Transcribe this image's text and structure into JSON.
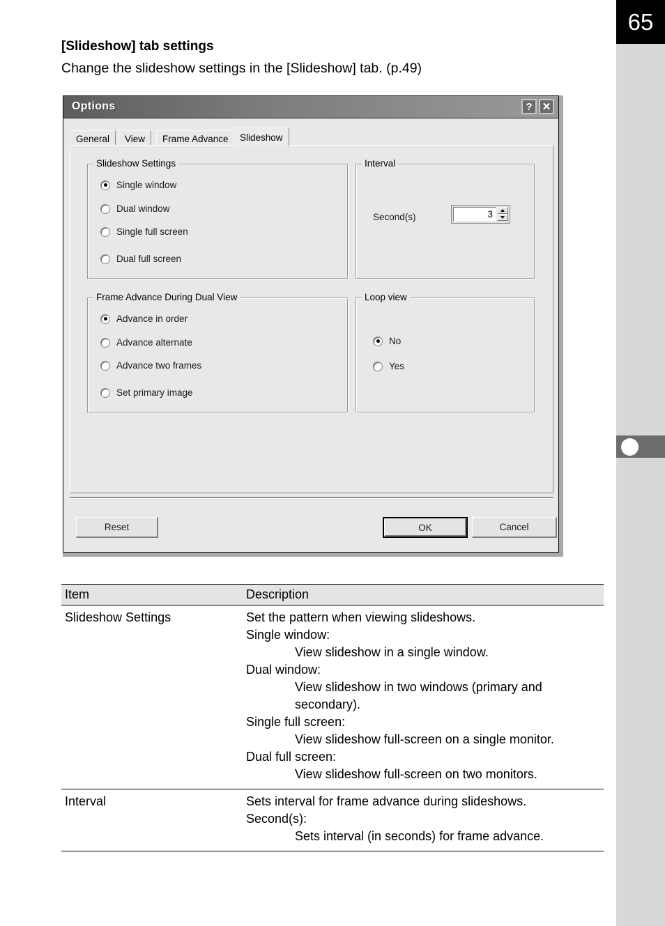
{
  "page": {
    "number": "65"
  },
  "heading": {
    "title": "[Slideshow] tab settings",
    "subtitle": "Change the slideshow settings in the [Slideshow] tab. (p.49)"
  },
  "dialog": {
    "title": "Options",
    "help_button": "?",
    "close_button": "✕",
    "tabs": [
      {
        "label": "General",
        "active": false
      },
      {
        "label": "View",
        "active": false
      },
      {
        "label": "Frame Advance",
        "active": false
      },
      {
        "label": "Slideshow",
        "active": true
      }
    ],
    "groups": {
      "slideshow_settings": {
        "title": "Slideshow Settings",
        "options": [
          {
            "label": "Single window",
            "checked": true
          },
          {
            "label": "Dual window",
            "checked": false
          },
          {
            "label": "Single full screen",
            "checked": false
          },
          {
            "label": "Dual full screen",
            "checked": false
          }
        ]
      },
      "interval": {
        "title": "Interval",
        "field_label": "Second(s)",
        "value": "3"
      },
      "frame_advance": {
        "title": "Frame Advance During Dual View",
        "options": [
          {
            "label": "Advance in order",
            "checked": true
          },
          {
            "label": "Advance alternate",
            "checked": false
          },
          {
            "label": "Advance two frames",
            "checked": false
          },
          {
            "label": "Set primary image",
            "checked": false
          }
        ]
      },
      "loop_view": {
        "title": "Loop view",
        "options": [
          {
            "label": "No",
            "checked": true
          },
          {
            "label": "Yes",
            "checked": false
          }
        ]
      }
    },
    "buttons": {
      "reset": "Reset",
      "ok": "OK",
      "cancel": "Cancel"
    }
  },
  "table": {
    "headers": [
      "Item",
      "Description"
    ],
    "rows": [
      {
        "item": "Slideshow Settings",
        "lines": [
          {
            "indent": 0,
            "text": "Set the pattern when viewing slideshows."
          },
          {
            "indent": 0,
            "text": "Single window:"
          },
          {
            "indent": 1,
            "text": "View slideshow in a single window."
          },
          {
            "indent": 0,
            "text": "Dual window:"
          },
          {
            "indent": 1,
            "text": "View slideshow in two windows (primary and"
          },
          {
            "indent": 1,
            "text": "secondary)."
          },
          {
            "indent": 0,
            "text": "Single full screen:"
          },
          {
            "indent": 1,
            "text": "View slideshow full-screen on a single monitor."
          },
          {
            "indent": 0,
            "text": "Dual full screen:"
          },
          {
            "indent": 1,
            "text": "View slideshow full-screen on two monitors."
          }
        ]
      },
      {
        "item": "Interval",
        "lines": [
          {
            "indent": 0,
            "text": "Sets interval for frame advance during slideshows."
          },
          {
            "indent": 0,
            "text": "Second(s):"
          },
          {
            "indent": 1,
            "text": "Sets interval (in seconds) for frame advance."
          }
        ]
      }
    ]
  },
  "colors": {
    "page_badge_bg": "#000000",
    "sidebar_bg": "#d8d8d8",
    "side_tab_bg": "#6d6d6d",
    "dialog_bg": "#e8e8e8",
    "table_header_bg": "#e4e4e4"
  }
}
